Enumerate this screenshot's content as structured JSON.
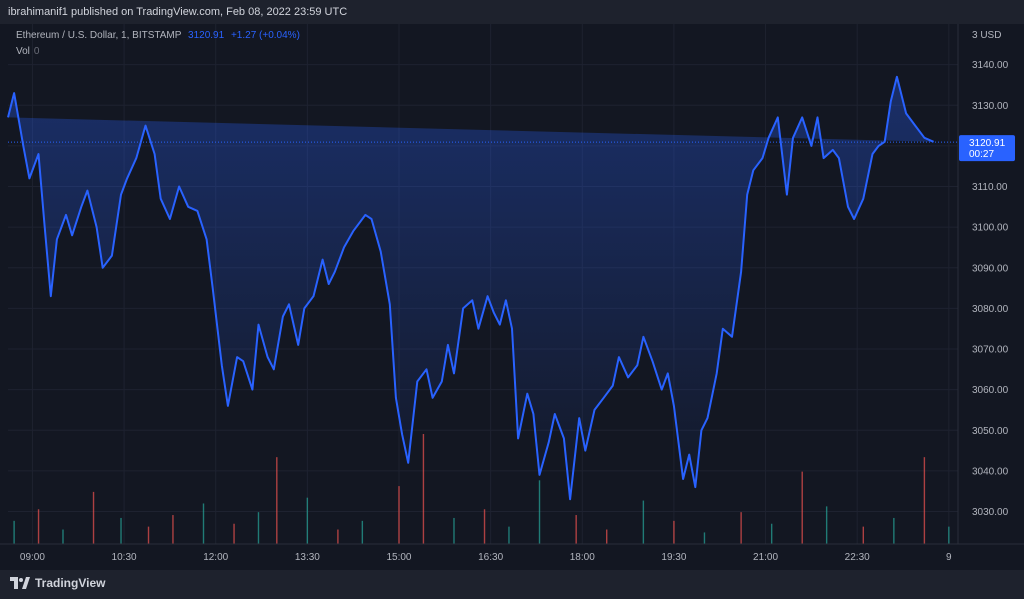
{
  "header": {
    "publisher_text": "ibrahimanif1 published on TradingView.com, Feb 08, 2022 23:59 UTC"
  },
  "legend": {
    "symbol": "Ethereum / U.S. Dollar, 1, BITSTAMP",
    "last": "3120.91",
    "change": "+1.27 (+0.04%)",
    "vol_label": "Vol",
    "vol_value": "0"
  },
  "currency_label": "3 USD",
  "price_badge": {
    "value": "3120.91",
    "countdown": "00:27"
  },
  "footer": {
    "brand": "TradingView"
  },
  "colors": {
    "background": "#131722",
    "line": "#2962ff",
    "grid": "#1e2230",
    "vol_up": "#26a69a",
    "vol_down": "#ef5350",
    "badge": "#2962ff"
  },
  "chart_data": {
    "type": "area",
    "title": "Ethereum / U.S. Dollar, 1, BITSTAMP",
    "xlabel": "",
    "ylabel": "",
    "ylim": [
      3022,
      3150
    ],
    "grid": true,
    "y_ticks": [
      "3030.00",
      "3040.00",
      "3050.00",
      "3060.00",
      "3070.00",
      "3080.00",
      "3090.00",
      "3100.00",
      "3110.00",
      "3120.00",
      "3130.00",
      "3140.00"
    ],
    "x_ticks": [
      "09:00",
      "10:30",
      "12:00",
      "13:30",
      "15:00",
      "16:30",
      "18:00",
      "19:30",
      "21:00",
      "22:30",
      "9"
    ],
    "x_tick_hours": [
      9,
      10.5,
      12,
      13.5,
      15,
      16.5,
      18,
      19.5,
      21,
      22.5,
      24
    ],
    "x_range_hours": [
      8.6,
      24.15
    ],
    "series": [
      {
        "x_hours": [
          8.6,
          8.7,
          8.85,
          8.95,
          9.1,
          9.2,
          9.3,
          9.4,
          9.55,
          9.65,
          9.8,
          9.9,
          10.05,
          10.15,
          10.3,
          10.45,
          10.55,
          10.7,
          10.85,
          11.0,
          11.1,
          11.25,
          11.4,
          11.55,
          11.7,
          11.85,
          11.95,
          12.1,
          12.2,
          12.35,
          12.45,
          12.6,
          12.7,
          12.85,
          12.95,
          13.1,
          13.2,
          13.35,
          13.45,
          13.6,
          13.75,
          13.85,
          13.95,
          14.1,
          14.25,
          14.45,
          14.55,
          14.7,
          14.85,
          14.95,
          15.05,
          15.15,
          15.3,
          15.45,
          15.55,
          15.7,
          15.8,
          15.9,
          16.05,
          16.2,
          16.3,
          16.45,
          16.55,
          16.65,
          16.75,
          16.85,
          16.95,
          17.1,
          17.2,
          17.3,
          17.45,
          17.55,
          17.7,
          17.8,
          17.95,
          18.05,
          18.2,
          18.35,
          18.5,
          18.6,
          18.75,
          18.9,
          19.0,
          19.15,
          19.3,
          19.4,
          19.5,
          19.65,
          19.75,
          19.85,
          19.95,
          20.05,
          20.2,
          20.3,
          20.45,
          20.6,
          20.7,
          20.8,
          20.95,
          21.05,
          21.2,
          21.35,
          21.45,
          21.6,
          21.75,
          21.85,
          21.95,
          22.1,
          22.2,
          22.35,
          22.45,
          22.6,
          22.75,
          22.85,
          22.95,
          23.05,
          23.15,
          23.3,
          23.45,
          23.6,
          23.75,
          23.85,
          23.95
        ],
        "values": [
          3127,
          3133,
          3120,
          3112,
          3118,
          3100,
          3083,
          3097,
          3103,
          3098,
          3105,
          3109,
          3100,
          3090,
          3093,
          3108,
          3112,
          3117,
          3125,
          3118,
          3107,
          3102,
          3110,
          3105,
          3104,
          3097,
          3085,
          3066,
          3056,
          3068,
          3067,
          3060,
          3076,
          3068,
          3065,
          3078,
          3081,
          3071,
          3080,
          3083,
          3092,
          3086,
          3089,
          3095,
          3099,
          3103,
          3102,
          3094,
          3081,
          3058,
          3049,
          3042,
          3062,
          3065,
          3058,
          3062,
          3071,
          3064,
          3080,
          3082,
          3075,
          3083,
          3079,
          3076,
          3082,
          3075,
          3048,
          3059,
          3054,
          3039,
          3047,
          3054,
          3048,
          3033,
          3053,
          3045,
          3055,
          3058,
          3061,
          3068,
          3063,
          3066,
          3073,
          3067,
          3060,
          3064,
          3056,
          3038,
          3044,
          3036,
          3050,
          3053,
          3064,
          3075,
          3073,
          3089,
          3108,
          3114,
          3117,
          3122,
          3127,
          3108,
          3122,
          3127,
          3120,
          3127,
          3117,
          3119,
          3117,
          3105,
          3102,
          3107,
          3118,
          3120,
          3121,
          3131,
          3137,
          3128,
          3125,
          3122,
          3121
        ]
      }
    ],
    "volume": {
      "x_hours": [
        8.7,
        9.1,
        9.5,
        10.0,
        10.45,
        10.9,
        11.3,
        11.8,
        12.3,
        12.7,
        13.0,
        13.5,
        14.0,
        14.4,
        15.0,
        15.4,
        15.9,
        16.4,
        16.8,
        17.3,
        17.9,
        18.4,
        19.0,
        19.5,
        20.0,
        20.6,
        21.1,
        21.6,
        22.0,
        22.6,
        23.1,
        23.6,
        24.0
      ],
      "values": [
        8,
        12,
        5,
        18,
        9,
        6,
        10,
        14,
        7,
        11,
        30,
        16,
        5,
        8,
        20,
        38,
        9,
        12,
        6,
        22,
        10,
        5,
        15,
        8,
        4,
        11,
        7,
        25,
        13,
        6,
        9,
        30,
        6
      ],
      "up": [
        true,
        false,
        true,
        false,
        true,
        false,
        false,
        true,
        false,
        true,
        false,
        true,
        false,
        true,
        false,
        false,
        true,
        false,
        true,
        true,
        false,
        false,
        true,
        false,
        true,
        false,
        true,
        false,
        true,
        false,
        true,
        false,
        true
      ]
    }
  }
}
